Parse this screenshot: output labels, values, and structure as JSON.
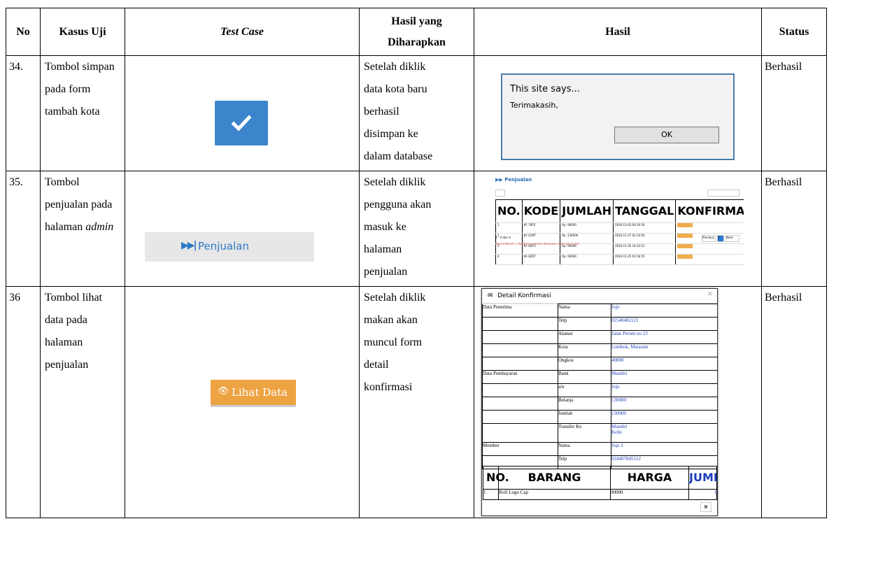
{
  "headers": {
    "no": "No",
    "kasus_uji": "Kasus Uji",
    "test_case": "Test Case",
    "hasil_diharapkan_1": "Hasil yang",
    "hasil_diharapkan_2": "Diharapkan",
    "hasil": "Hasil",
    "status": "Status"
  },
  "rows": [
    {
      "no": "34.",
      "kasus": [
        "Tombol simpan",
        "pada form",
        "tambah kota"
      ],
      "harapan": [
        "Setelah diklik",
        "data kota baru",
        "berhasil",
        "disimpan ke",
        "dalam database"
      ],
      "status": "Berhasil",
      "dialog": {
        "title": "This site says...",
        "message": "Terimakasih,",
        "ok": "OK"
      },
      "button_icon": "check-icon"
    },
    {
      "no": "35.",
      "kasus": [
        "Tombol",
        "penjualan pada",
        "halaman"
      ],
      "kasus_italic": "admin",
      "harapan": [
        "Setelah diklik",
        "pengguna akan",
        "masuk ke",
        "halaman",
        "penjualan"
      ],
      "status": "Berhasil",
      "button_label": "Penjualan",
      "button_icon": "fast-forward-icon",
      "mini": {
        "title": "Penjualan",
        "columns": [
          "NO.",
          "KODE",
          "JUMLAH",
          "TANGGAL",
          "KONFIRMASI"
        ],
        "rows": [
          [
            "1",
            "KF-76FR",
            "Rp. 90000",
            "2016-12-03 00:16:54"
          ],
          [
            "2",
            "KF-Q49T",
            "Rp. 130000",
            "2016-11-27 01:10:50"
          ],
          [
            "3",
            "KF-Q8T2",
            "Rp. 90000",
            "2016-11-26 14:33:12"
          ],
          [
            "4",
            "KF-SQ5T",
            "Rp. 90000",
            "2016-11-25 01:16:55"
          ]
        ],
        "footer": "1 - 4 dari 4",
        "note": "Warna Merah = Konfirmasi belum dilakukan lebih dari 2 jam.",
        "pager_prev": "Previous",
        "pager_page": "1",
        "pager_next": "Next"
      }
    },
    {
      "no": "36",
      "kasus": [
        "Tombol lihat",
        "data pada",
        "halaman",
        "penjualan"
      ],
      "harapan": [
        "Setelah diklik",
        "makan akan",
        "muncul form",
        "detail",
        "konfirmasi"
      ],
      "status": "Berhasil",
      "button_label": "Lihat Data",
      "button_icon": "eye-icon",
      "modal": {
        "title": "Detail Konfirmasi",
        "sections": {
          "penerima": "Data Penerima",
          "pembayaran": "Data Pembayaran",
          "member": "Member"
        },
        "penerima": [
          [
            "Nama",
            "Jojo"
          ],
          [
            "Telp",
            "02548482121"
          ],
          [
            "Alamat",
            "Jalan Perum no 23"
          ],
          [
            "Kota",
            "Lombok, Mataram"
          ],
          [
            "Ongkos",
            "40000"
          ]
        ],
        "pembayaran": [
          [
            "Bank",
            "Mandiri"
          ],
          [
            "a/n",
            "Jojo"
          ],
          [
            "Belanja",
            "130000"
          ],
          [
            "Jumlah",
            "130000"
          ],
          [
            "Transfer Ke",
            "Mandiri",
            "Kelis"
          ]
        ],
        "member": [
          [
            "Nama",
            "Jojo 2"
          ],
          [
            "Telp",
            "024487845512"
          ]
        ],
        "barang_headers": [
          "NO.",
          "BARANG",
          "HARGA",
          "JUMLAH"
        ],
        "barang_rows": [
          [
            "1",
            "Rofi Logo Cap",
            "90000",
            "1"
          ]
        ],
        "close": "×"
      }
    }
  ]
}
